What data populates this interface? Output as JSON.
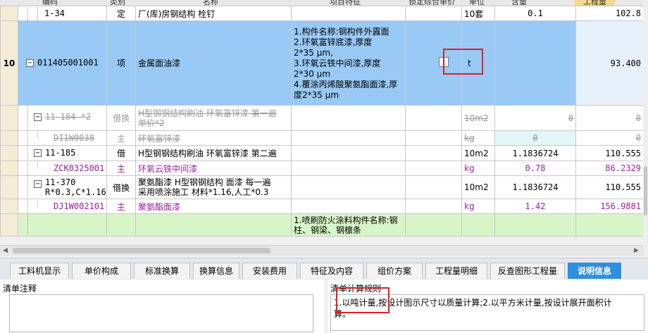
{
  "header": [
    "编码",
    "类别",
    "名称",
    "项目特征",
    "锁定综合单价",
    "单位",
    "含量",
    "工程量"
  ],
  "rows": [
    {
      "code": "1-34",
      "type": "定",
      "name": "厂(库)房钢结构 栓钉",
      "unit": "10套",
      "content": "0.1",
      "qty": "102.8"
    },
    {
      "num": "10",
      "code": "011405001001",
      "type": "项",
      "name": "金属面油漆",
      "feature": [
        "1.构件名称:钢构件外露面",
        "2.环氧富锌底漆,厚度",
        "2*35 μm,",
        "3.环氧云铁中间漆,厚度",
        "2*30 μm",
        "4.覆涂丙烯酸聚氨酯面漆,厚",
        "度2*35 μm"
      ],
      "unit": "t",
      "qty": "93.400"
    },
    {
      "code": "11-184 *2",
      "type": "借换",
      "name": "H型钢钢结构刷油 环氧富锌漆 第一遍",
      "name2": "单价*2",
      "unit": "10m2",
      "content": "0",
      "qty": "0"
    },
    {
      "code": "DI1W0038",
      "type": "主",
      "name": "环氧富锌漆",
      "unit": "kg",
      "content": "0",
      "qty": "0"
    },
    {
      "code": "11-185",
      "type": "借",
      "name": "H型钢钢结构刷油 环氧富锌漆 第二遍",
      "unit": "10m2",
      "content": "1.1836724",
      "qty": "110.555"
    },
    {
      "code": "ZCK0325001",
      "type": "主",
      "name": "环氧云铁中间漆",
      "unit": "kg",
      "content": "0.78",
      "qty": "86.2329"
    },
    {
      "code": "11-370",
      "code2": "R*0.3,C*1.16",
      "type": "借换",
      "name": "聚氨酯漆 H型钢钢结构 面漆 每一遍",
      "name2": "采用喷涂施工 材料*1.16,人工*0.3",
      "unit": "10m2",
      "content": "1.1836724",
      "qty": "110.555"
    },
    {
      "code": "DJ1W002101",
      "type": "主",
      "name": "聚氨酯面漆",
      "unit": "kg",
      "content": "1.42",
      "qty": "156.9881"
    },
    {
      "feature": [
        "1.喷刷防火涂料构件名称:钢",
        "柱、钢梁、钢檩条"
      ]
    }
  ],
  "tabs": [
    "工料机显示",
    "单价构成",
    "标准换算",
    "换算信息",
    "安装费用",
    "特征及内容",
    "组价方案",
    "工程量明细",
    "反查图形工程量",
    "说明信息"
  ],
  "active_tab": "说明信息",
  "notes_title": "清单注释",
  "rules_title": "清单计算规则",
  "rules_text_line1": "1.以吨计量,按设计图示尺寸以质量计算;2.以平方米计量,按设计展开面积计",
  "rules_text_line2": "算。"
}
